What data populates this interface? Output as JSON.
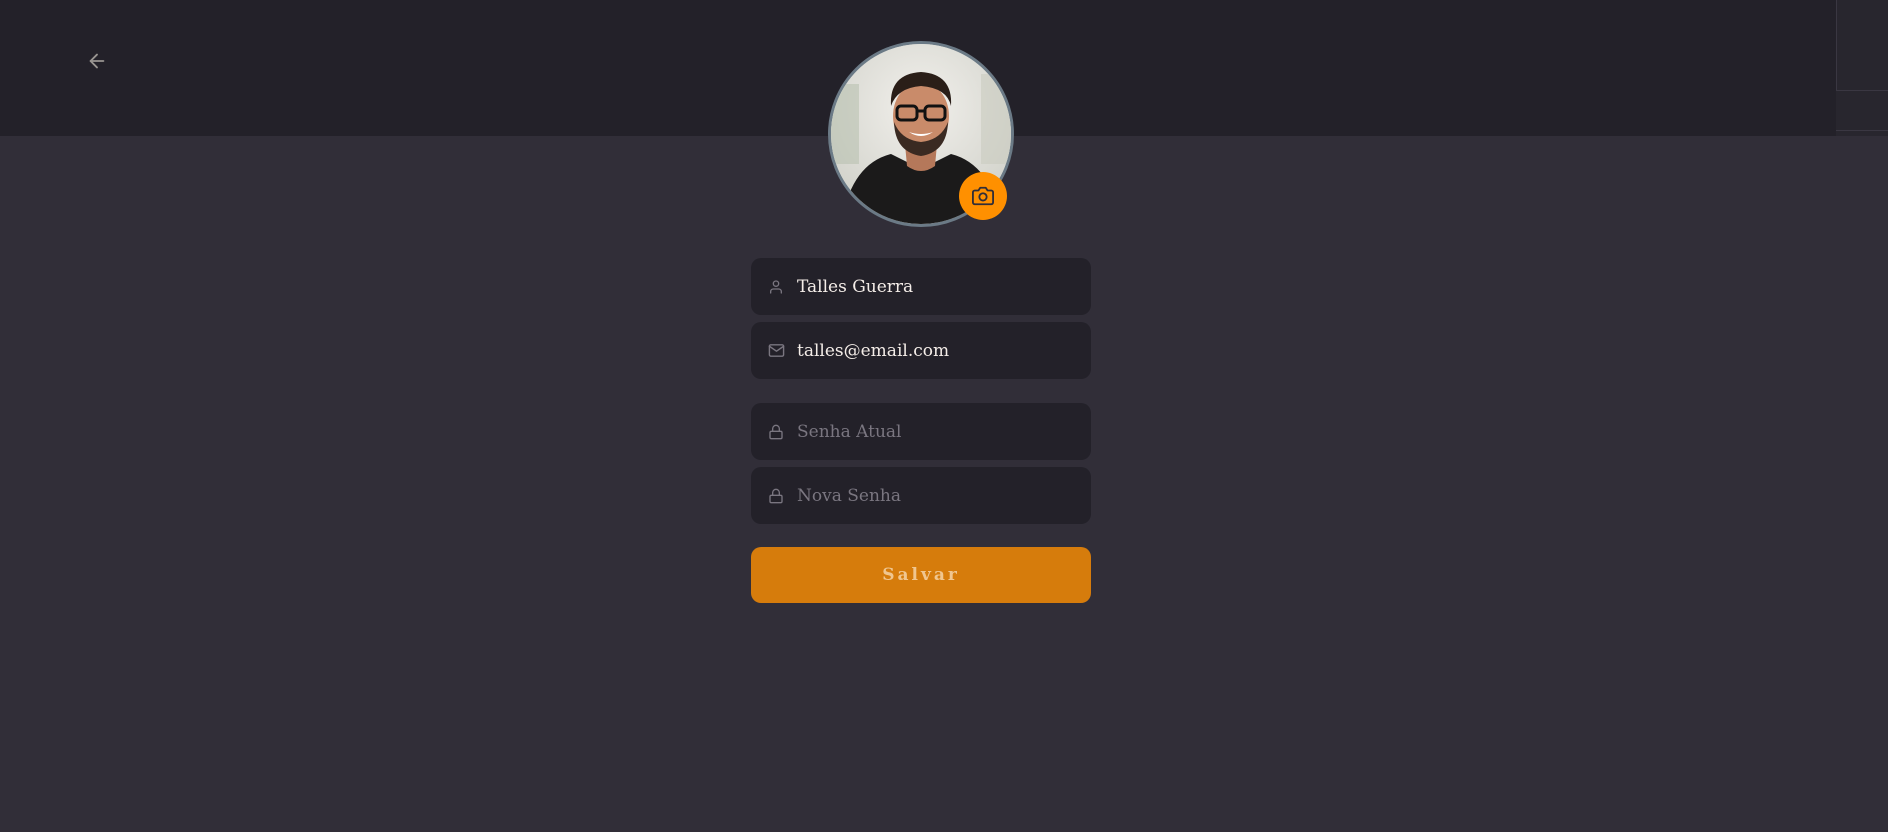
{
  "header": {
    "back_icon": "arrow-left-icon"
  },
  "profile": {
    "avatar_description_icon": "avatar-photo",
    "camera_icon": "camera-icon",
    "accent_color": "#ff9000"
  },
  "form": {
    "name": {
      "icon": "user-icon",
      "value": "Talles Guerra"
    },
    "email": {
      "icon": "mail-icon",
      "value": "talles@email.com"
    },
    "current_password": {
      "icon": "lock-icon",
      "placeholder": "Senha Atual"
    },
    "new_password": {
      "icon": "lock-icon",
      "placeholder": "Nova Senha"
    },
    "save_label": "Salvar"
  },
  "colors": {
    "background": "#312e38",
    "header": "#232129",
    "input_bg": "#232129",
    "button": "#d67c0c"
  }
}
